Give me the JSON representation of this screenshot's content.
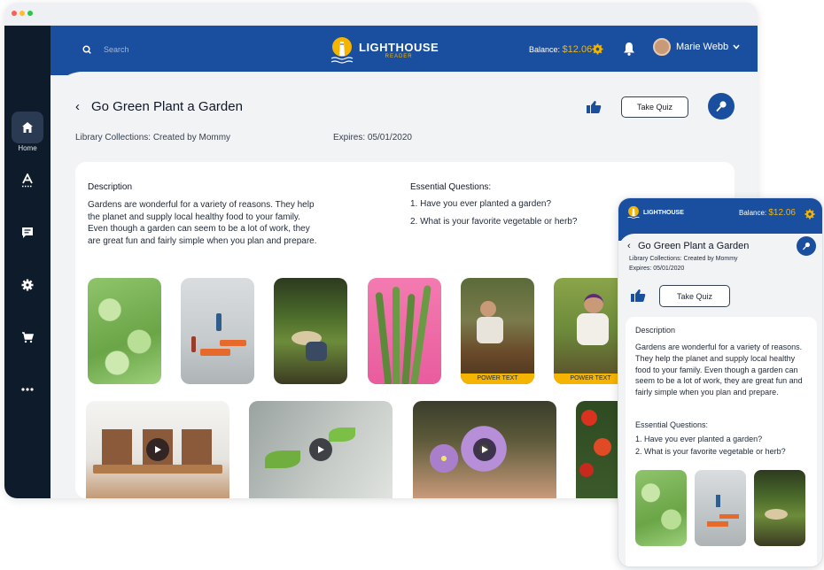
{
  "window": {
    "dots": [
      "#ff5f57",
      "#febc2e",
      "#28c840"
    ]
  },
  "sidebar": {
    "home_label": "Home"
  },
  "header": {
    "search_placeholder": "Search",
    "brand_name": "LIGHTHOUSE",
    "brand_sub": "READER",
    "balance_label": "Balance:",
    "balance_value": "$12.06",
    "user_name": "Marie Webb"
  },
  "book": {
    "title": "Go Green Plant a Garden",
    "collection": "Library Collections: Created by Mommy",
    "expires": "Expires: 05/01/2020",
    "take_quiz": "Take Quiz"
  },
  "content": {
    "description_heading": "Description",
    "description": "Gardens are wonderful for a variety of reasons. They help the planet and supply local healthy food to your family. Even though a garden can seem to be a lot of work, they are great fun and fairly simple when you plan and prepare.",
    "questions_heading": "Essential Questions:",
    "questions": [
      "1. Have you ever planted a garden?",
      "2. What is your favorite vegetable or herb?"
    ],
    "power_text": "POWER TEXT"
  },
  "mobile": {
    "brand_name": "LIGHTHOUSE",
    "balance_label": "Balance:",
    "balance_value": "$12.06",
    "title": "Go Green Plant a Garden",
    "collection": "Library Collections: Created by Mommy",
    "expires": "Expires: 05/01/2020",
    "take_quiz": "Take Quiz",
    "description_heading": "Description",
    "description": "Gardens are wonderful for a variety of reasons. They help the planet and supply local healthy food to your family. Even though a garden can seem to be a lot of work, they are great fun and fairly simple when you plan and prepare.",
    "questions_heading": "Essential Questions:",
    "q1": "1. Have you ever planted a garden?",
    "q2": "2. What is your favorite vegetable or herb?"
  },
  "colors": {
    "brand_blue": "#1a4fa0",
    "sidebar_dark": "#0e1b2b",
    "accent_yellow": "#f5b400"
  }
}
